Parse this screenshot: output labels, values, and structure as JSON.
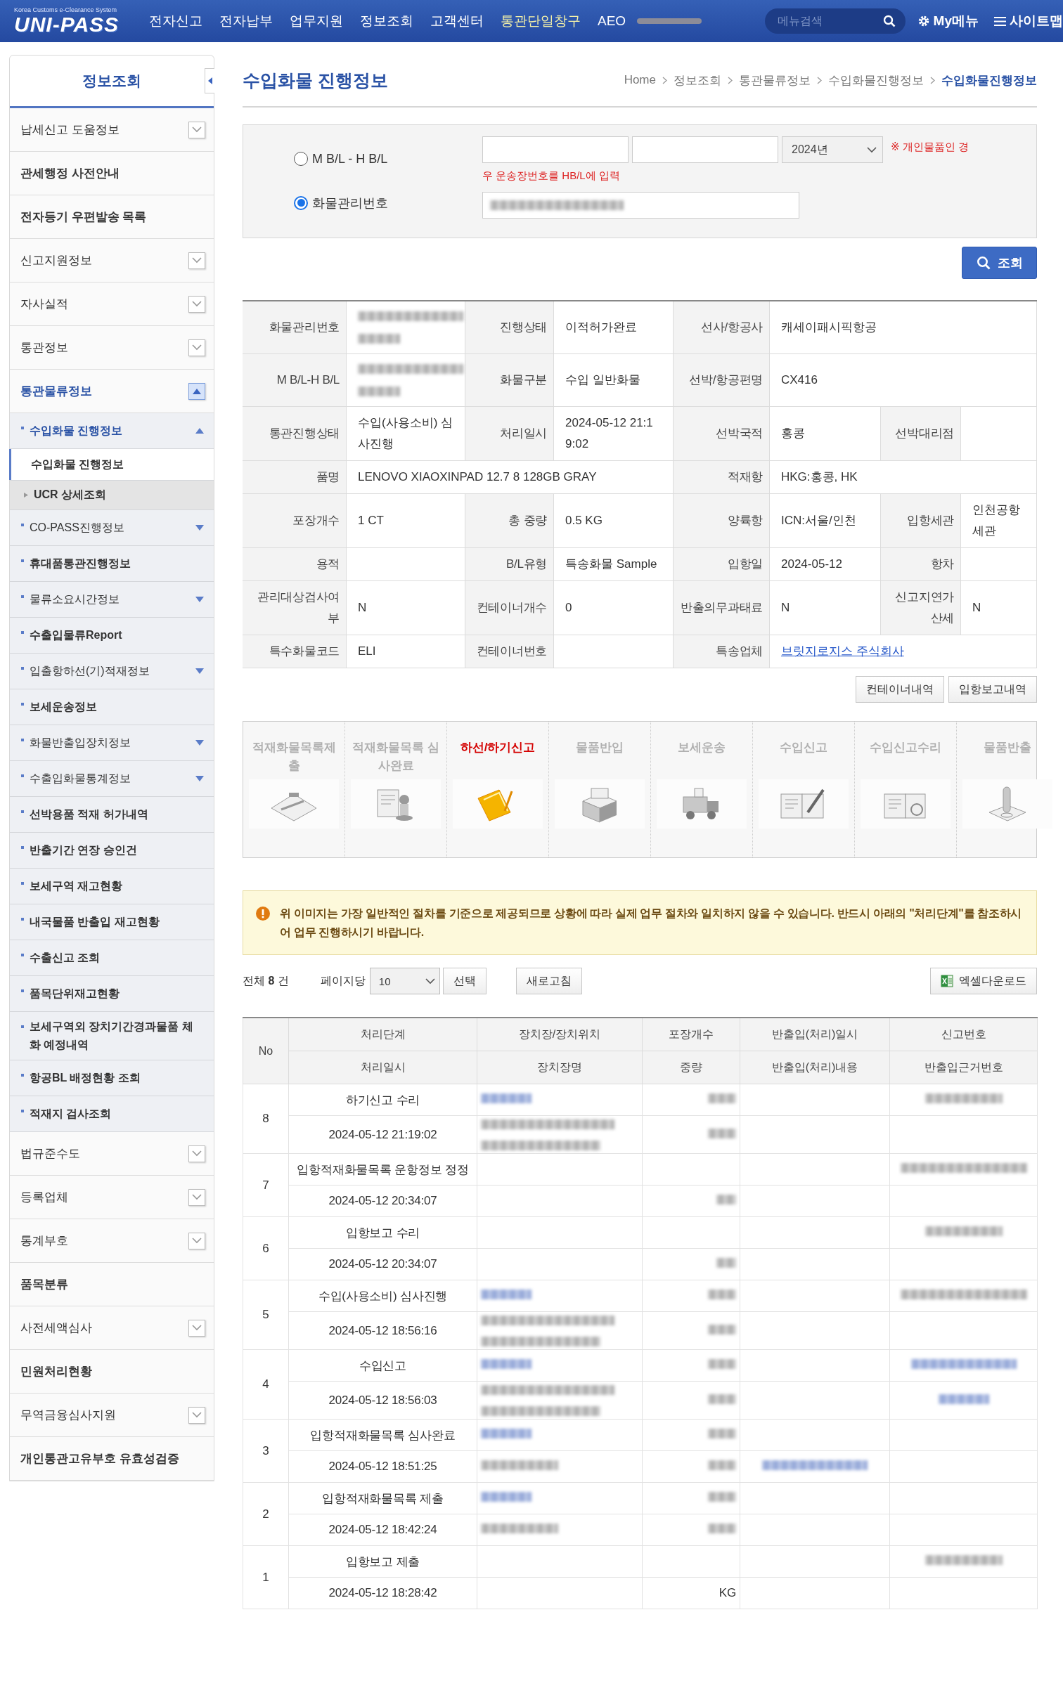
{
  "header": {
    "tagline": "Korea Customs e-Clearance System",
    "logo": "UNI-PASS",
    "nav": [
      {
        "label": "전자신고",
        "highlight": false
      },
      {
        "label": "전자납부",
        "highlight": false
      },
      {
        "label": "업무지원",
        "highlight": false
      },
      {
        "label": "정보조회",
        "highlight": false
      },
      {
        "label": "고객센터",
        "highlight": false
      },
      {
        "label": "통관단일창구",
        "highlight": true
      },
      {
        "label": "AEO",
        "highlight": false
      }
    ],
    "search": {
      "placeholder": "메뉴검색"
    },
    "my_menu": "My메뉴",
    "sitemap": "사이트맵"
  },
  "sidebar": {
    "title": "정보조회",
    "sections": [
      {
        "label": "납세신고 도움정보",
        "submenu": true,
        "expanded": false,
        "selected": false
      },
      {
        "label": "관세행정 사전안내",
        "submenu": false,
        "selected": false
      },
      {
        "label": "전자등기 우편발송 목록",
        "submenu": false,
        "selected": false
      },
      {
        "label": "신고지원정보",
        "submenu": true,
        "expanded": false,
        "selected": false
      },
      {
        "label": "자사실적",
        "submenu": true,
        "expanded": false,
        "selected": false
      },
      {
        "label": "통관정보",
        "submenu": true,
        "expanded": false,
        "selected": false
      },
      {
        "label": "통관물류정보",
        "submenu": true,
        "expanded": true,
        "selected": true,
        "children": [
          {
            "label": "수입화물 진행정보",
            "submenu": true,
            "expanded": true,
            "selected": true,
            "children": [
              {
                "label": "수입화물 진행정보",
                "selected": true
              },
              {
                "label": "UCR 상세조회",
                "selected": false
              }
            ]
          },
          {
            "label": "CO-PASS진행정보",
            "submenu": true,
            "expanded": false,
            "selected": false
          },
          {
            "label": "휴대품통관진행정보",
            "submenu": false,
            "selected": false
          },
          {
            "label": "물류소요시간정보",
            "submenu": true,
            "expanded": false,
            "selected": false
          },
          {
            "label": "수출입물류Report",
            "submenu": false,
            "selected": false
          },
          {
            "label": "입출항하선(기)적재정보",
            "submenu": true,
            "expanded": false,
            "selected": false
          },
          {
            "label": "보세운송정보",
            "submenu": false,
            "selected": false
          },
          {
            "label": "화물반출입장치정보",
            "submenu": true,
            "expanded": false,
            "selected": false
          },
          {
            "label": "수출입화물통계정보",
            "submenu": true,
            "expanded": false,
            "selected": false
          },
          {
            "label": "선박용품 적재 허가내역",
            "submenu": false,
            "selected": false
          },
          {
            "label": "반출기간 연장 승인건",
            "submenu": false,
            "selected": false
          },
          {
            "label": "보세구역 재고현황",
            "submenu": false,
            "selected": false
          },
          {
            "label": "내국물품 반출입 재고현황",
            "submenu": false,
            "selected": false
          },
          {
            "label": "수출신고 조회",
            "submenu": false,
            "selected": false
          },
          {
            "label": "품목단위재고현황",
            "submenu": false,
            "selected": false
          },
          {
            "label": "보세구역외 장치기간경과물품 체화 예정내역",
            "submenu": false,
            "selected": false
          },
          {
            "label": "항공BL 배정현황 조회",
            "submenu": false,
            "selected": false
          },
          {
            "label": "적재지 검사조회",
            "submenu": false,
            "selected": false
          }
        ]
      },
      {
        "label": "법규준수도",
        "submenu": true,
        "expanded": false,
        "selected": false
      },
      {
        "label": "등록업체",
        "submenu": true,
        "expanded": false,
        "selected": false
      },
      {
        "label": "통계부호",
        "submenu": true,
        "expanded": false,
        "selected": false
      },
      {
        "label": "품목분류",
        "submenu": false,
        "selected": false
      },
      {
        "label": "사전세액심사",
        "submenu": true,
        "expanded": false,
        "selected": false
      },
      {
        "label": "민원처리현황",
        "submenu": false,
        "selected": false
      },
      {
        "label": "무역금융심사지원",
        "submenu": true,
        "expanded": false,
        "selected": false
      },
      {
        "label": "개인통관고유부호 유효성검증",
        "submenu": false,
        "selected": false
      }
    ]
  },
  "page": {
    "title": "수입화물 진행정보",
    "breadcrumb": [
      {
        "label": "Home",
        "current": false
      },
      {
        "label": "정보조회",
        "current": false
      },
      {
        "label": "통관물류정보",
        "current": false
      },
      {
        "label": "수입화물진행정보",
        "current": false
      },
      {
        "label": "수입화물진행정보",
        "current": true
      }
    ]
  },
  "search_form": {
    "options": [
      {
        "label": "M B/L - H B/L",
        "selected": false
      },
      {
        "label": "화물관리번호",
        "selected": true
      }
    ],
    "year": "2024년",
    "note": "※ 개인물품인 경",
    "hint": "우 운송장번호를 HB/L에 입력",
    "cargo_number": {
      "redacted": true
    },
    "button": "조회"
  },
  "detail": [
    [
      {
        "kind": "label",
        "text": "화물관리번호"
      },
      {
        "kind": "value",
        "redacted": true
      },
      {
        "kind": "label",
        "text": "진행상태"
      },
      {
        "kind": "value",
        "text": "이적허가완료"
      },
      {
        "kind": "label",
        "text": "선사/항공사"
      },
      {
        "kind": "value",
        "text": "캐세이패시픽항공"
      }
    ],
    [
      {
        "kind": "label",
        "text": "M B/L-H B/L"
      },
      {
        "kind": "value",
        "redacted": true
      },
      {
        "kind": "label",
        "text": "화물구분"
      },
      {
        "kind": "value",
        "text": "수입 일반화물"
      },
      {
        "kind": "label",
        "text": "선박/항공편명"
      },
      {
        "kind": "value",
        "text": "CX416"
      }
    ],
    [
      {
        "kind": "label",
        "text": "통관진행상태"
      },
      {
        "kind": "value",
        "text": "수입(사용소비) 심사진행"
      },
      {
        "kind": "label",
        "text": "처리일시"
      },
      {
        "kind": "value",
        "text": "2024-05-12 21:19:02"
      },
      {
        "kind": "label",
        "text": "선박국적"
      },
      {
        "kind": "value",
        "text": "홍콩"
      },
      {
        "kind": "label",
        "text": "선박대리점"
      },
      {
        "kind": "value"
      }
    ],
    [
      {
        "kind": "label",
        "text": "품명"
      },
      {
        "kind": "value",
        "text": "LENOVO XIAOXINPAD 12.7 8 128GB GRAY"
      },
      {
        "kind": "label",
        "text": "적재항"
      },
      {
        "kind": "value",
        "text": "HKG:홍콩, HK"
      }
    ],
    [
      {
        "kind": "label",
        "text": "포장개수"
      },
      {
        "kind": "value",
        "text": "1 CT"
      },
      {
        "kind": "label",
        "text": "총 중량"
      },
      {
        "kind": "value",
        "text": "0.5 KG"
      },
      {
        "kind": "label",
        "text": "양륙항"
      },
      {
        "kind": "value",
        "text": "ICN:서울/인천"
      },
      {
        "kind": "label",
        "text": "입항세관"
      },
      {
        "kind": "value",
        "text": "인천공항세관"
      }
    ],
    [
      {
        "kind": "label",
        "text": "용적"
      },
      {
        "kind": "value"
      },
      {
        "kind": "label",
        "text": "B/L유형"
      },
      {
        "kind": "value",
        "text": "특송화물 Sample"
      },
      {
        "kind": "label",
        "text": "입항일"
      },
      {
        "kind": "value",
        "text": "2024-05-12"
      },
      {
        "kind": "label",
        "text": "항차"
      },
      {
        "kind": "value"
      }
    ],
    [
      {
        "kind": "label",
        "text": "관리대상검사여부"
      },
      {
        "kind": "value",
        "text": "N"
      },
      {
        "kind": "label",
        "text": "컨테이너개수"
      },
      {
        "kind": "value",
        "text": "0"
      },
      {
        "kind": "label",
        "text": "반출의무과태료"
      },
      {
        "kind": "value",
        "text": "N"
      },
      {
        "kind": "label",
        "text": "신고지연가산세"
      },
      {
        "kind": "value",
        "text": "N"
      }
    ],
    [
      {
        "kind": "label",
        "text": "특수화물코드"
      },
      {
        "kind": "value",
        "text": "ELI"
      },
      {
        "kind": "label",
        "text": "컨테이너번호"
      },
      {
        "kind": "value"
      },
      {
        "kind": "label",
        "text": "특송업체"
      },
      {
        "kind": "value",
        "text": "브릿지로지스 주식회사",
        "link": true
      }
    ]
  ],
  "detail_buttons": [
    "컨테이너내역",
    "입항보고내역"
  ],
  "steps": [
    {
      "label": "적재화물목록제출",
      "active": false
    },
    {
      "label": "적재화물목록 심사완료",
      "active": false
    },
    {
      "label": "하선/하기신고",
      "active": true
    },
    {
      "label": "물품반입",
      "active": false
    },
    {
      "label": "보세운송",
      "active": false
    },
    {
      "label": "수입신고",
      "active": false
    },
    {
      "label": "수입신고수리",
      "active": false
    },
    {
      "label": "물품반출",
      "active": false
    }
  ],
  "notice": "위 이미지는 가장 일반적인 절차를 기준으로 제공되므로 상황에 따라 실제 업무 절차와 일치하지 않을 수 있습니다. 반드시 아래의 **\"처리단계\"**를 참조하시어 업무 진행하시기 바랍니다.",
  "toolbar": {
    "total": "전체 **8** 건",
    "per_page_label": "페이지당",
    "per_page": "10",
    "select_button": "선택",
    "refresh_button": "새로고침",
    "excel_button": "엑셀다운로드"
  },
  "results": {
    "columns_top": [
      "No",
      "처리단계",
      "장치장/장치위치",
      "포장개수",
      "반출입(처리)일시",
      "신고번호"
    ],
    "columns_bottom": [
      "처리일시",
      "장치장명",
      "중량",
      "반출입(처리)내용",
      "반출입근거번호"
    ],
    "rows": [
      {
        "no": "8",
        "stage": "하기신고 수리",
        "date": "2024-05-12 21:19:02",
        "store": {
          "kind": "blur_link"
        },
        "packages": {
          "kind": "blur_small"
        },
        "declaration_no": {
          "kind": "blur_text"
        },
        "store_name": {
          "kind": "blur_text_2"
        },
        "weight": {
          "kind": "blur_small"
        }
      },
      {
        "no": "7",
        "stage": "입항적재화물목록 운항정보 정정",
        "date": "2024-05-12 20:34:07",
        "declaration_no": {
          "kind": "blur_text_wide"
        },
        "weight": {
          "kind": "blur_tiny"
        }
      },
      {
        "no": "6",
        "stage": "입항보고 수리",
        "date": "2024-05-12 20:34:07",
        "declaration_no": {
          "kind": "blur_text"
        },
        "weight": {
          "kind": "blur_tiny"
        }
      },
      {
        "no": "5",
        "stage": "수입(사용소비) 심사진행",
        "date": "2024-05-12 18:56:16",
        "store": {
          "kind": "blur_link"
        },
        "packages": {
          "kind": "blur_small"
        },
        "declaration_no": {
          "kind": "blur_text_wide"
        },
        "store_name": {
          "kind": "blur_text_2"
        },
        "weight": {
          "kind": "blur_small"
        }
      },
      {
        "no": "4",
        "stage": "수입신고",
        "date": "2024-05-12 18:56:03",
        "store": {
          "kind": "blur_link"
        },
        "packages": {
          "kind": "blur_small"
        },
        "declaration_no": {
          "kind": "blur_link_wide"
        },
        "store_name": {
          "kind": "blur_text_2"
        },
        "weight": {
          "kind": "blur_small"
        },
        "basis_no": {
          "kind": "blur_link"
        }
      },
      {
        "no": "3",
        "stage": "입항적재화물목록 심사완료",
        "date": "2024-05-12 18:51:25",
        "store": {
          "kind": "blur_link"
        },
        "packages": {
          "kind": "blur_small"
        },
        "store_name": {
          "kind": "blur_text"
        },
        "weight": {
          "kind": "blur_small"
        },
        "inout_detail": {
          "kind": "blur_link_wide"
        }
      },
      {
        "no": "2",
        "stage": "입항적재화물목록 제출",
        "date": "2024-05-12 18:42:24",
        "store": {
          "kind": "blur_link"
        },
        "packages": {
          "kind": "blur_small"
        },
        "store_name": {
          "kind": "blur_text"
        },
        "weight": {
          "kind": "blur_small"
        }
      },
      {
        "no": "1",
        "stage": "입항보고 제출",
        "date": "2024-05-12 18:28:42",
        "declaration_no": {
          "kind": "blur_text"
        },
        "weight": {
          "kind": "text",
          "text": "KG"
        }
      }
    ]
  }
}
